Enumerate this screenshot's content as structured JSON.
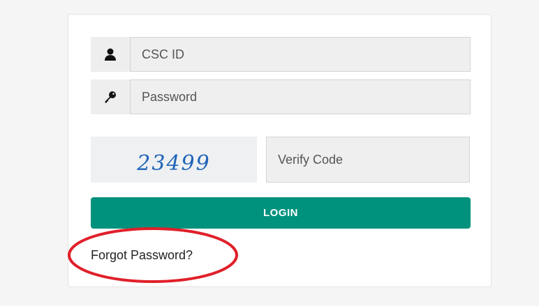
{
  "login_form": {
    "username": {
      "placeholder": "CSC ID",
      "value": "",
      "icon": "user-icon"
    },
    "password": {
      "placeholder": "Password",
      "value": "",
      "icon": "key-icon"
    },
    "captcha": {
      "text": "23499"
    },
    "verify_code": {
      "placeholder": "Verify Code",
      "value": ""
    },
    "login_label": "LOGIN",
    "forgot_password_label": "Forgot Password?"
  },
  "colors": {
    "accent": "#00927d",
    "annotation": "#e0202a",
    "captcha_text": "#1f63b8"
  }
}
